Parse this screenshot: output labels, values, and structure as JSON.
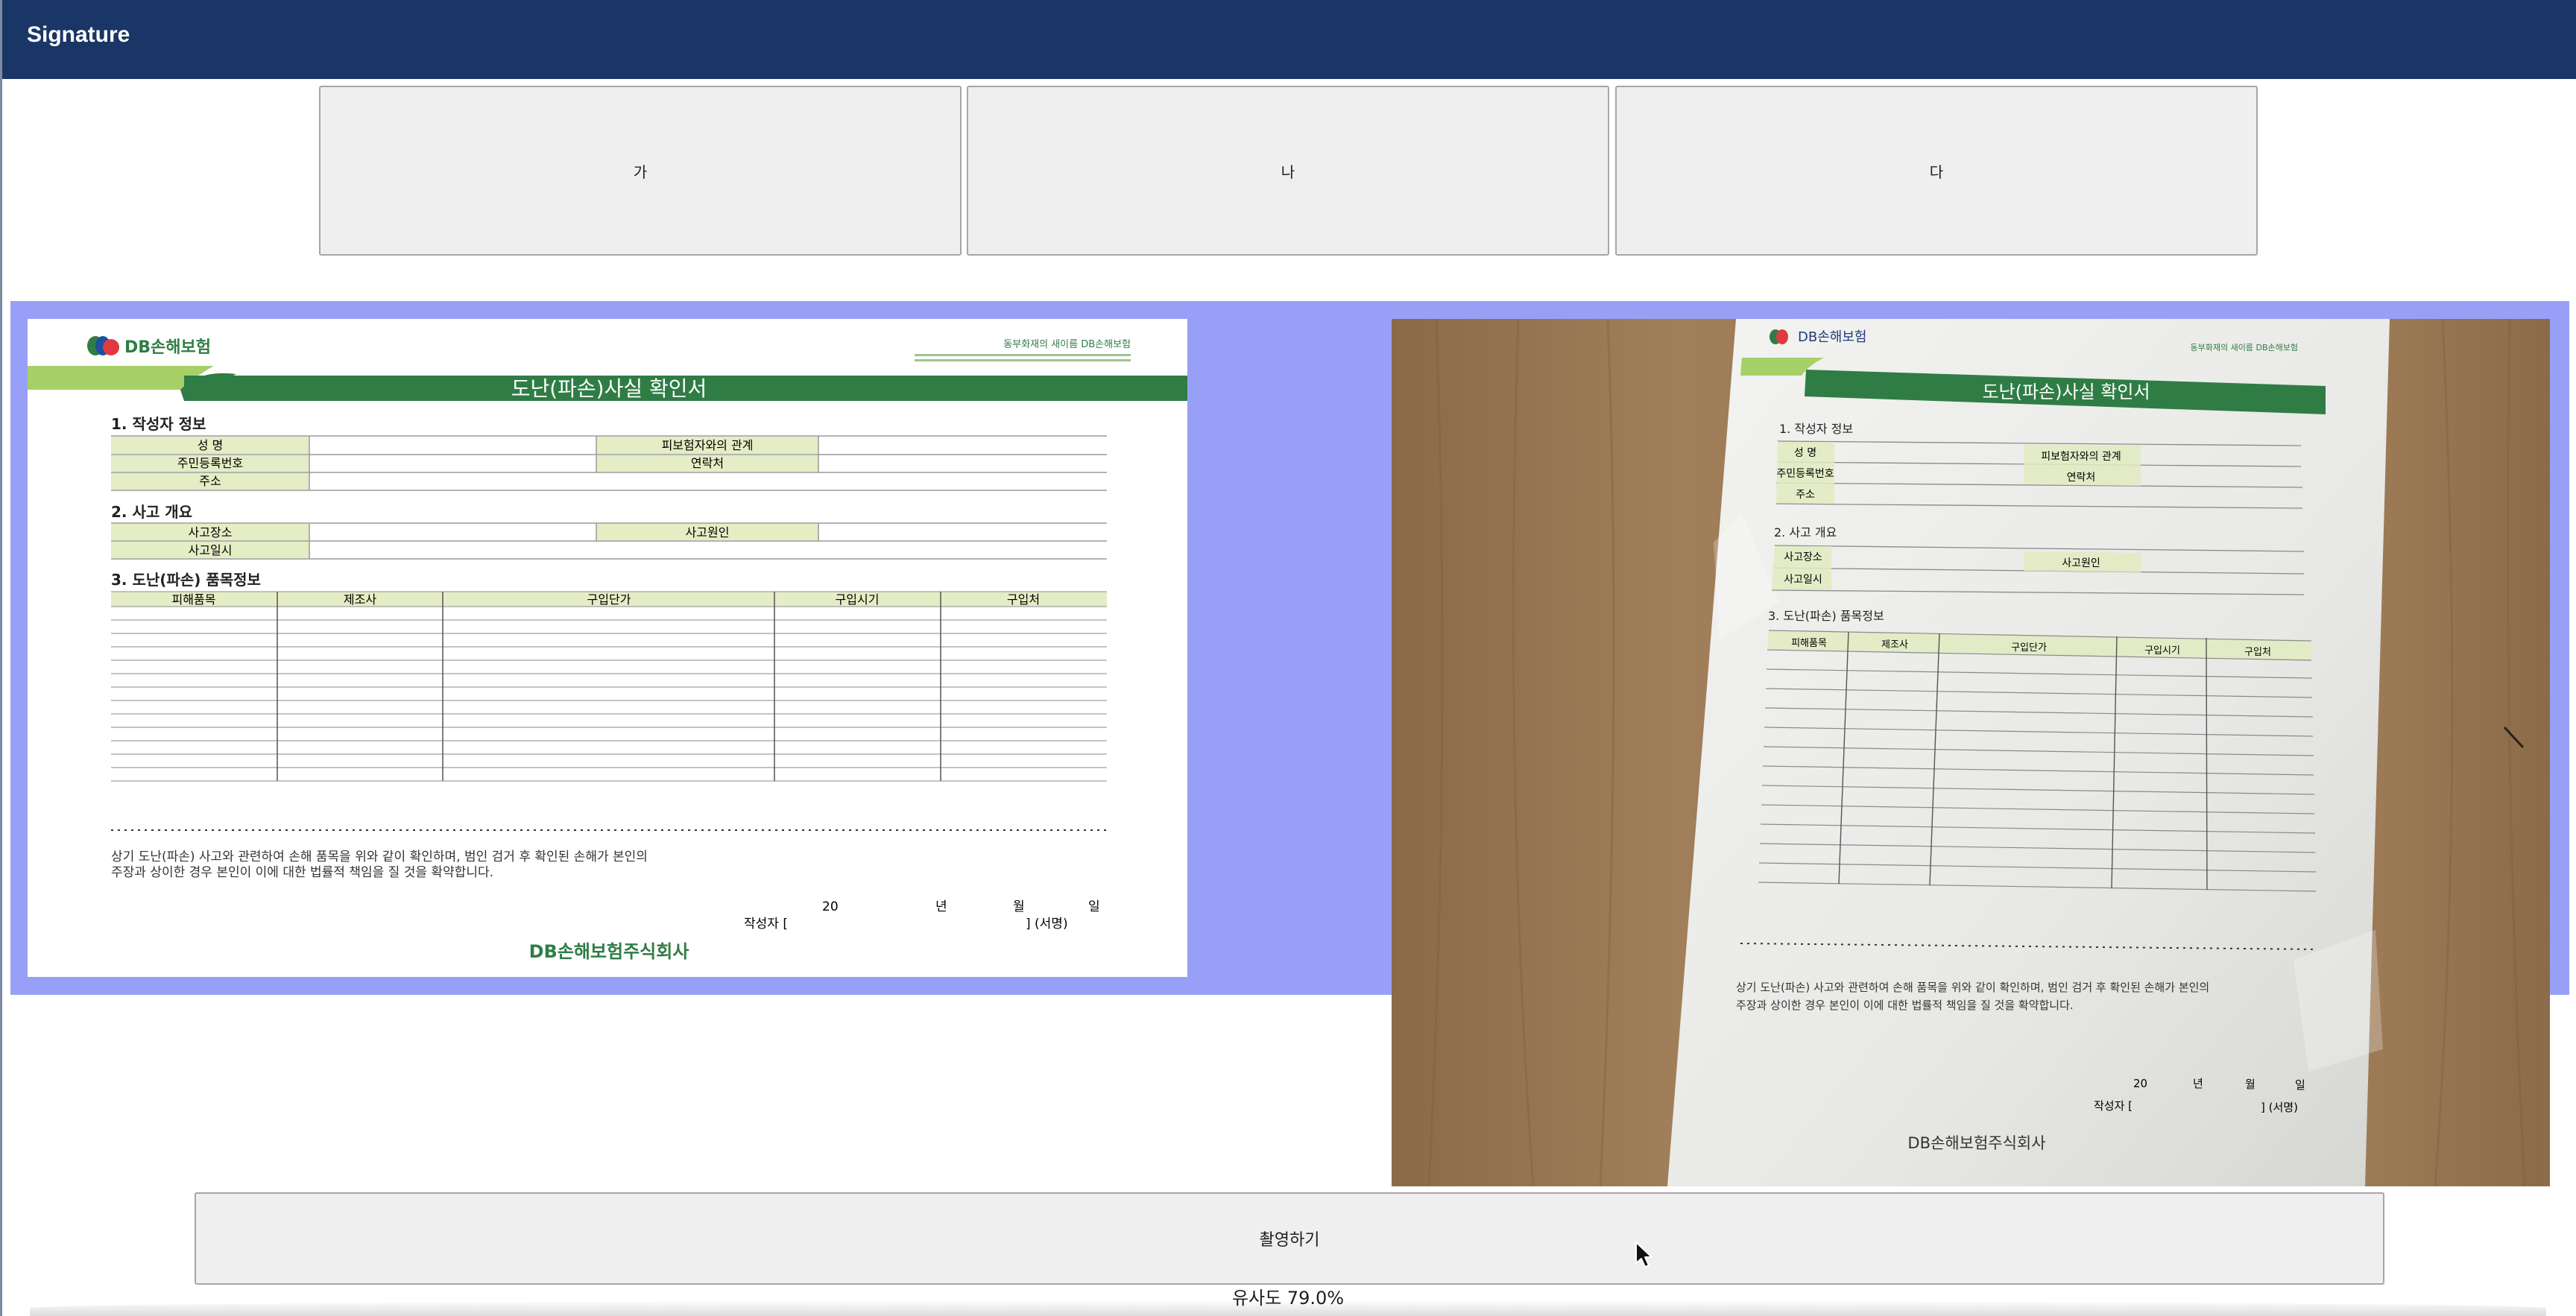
{
  "app": {
    "title": "Signature"
  },
  "options": [
    {
      "label": "가"
    },
    {
      "label": "나"
    },
    {
      "label": "다"
    }
  ],
  "colors": {
    "header": "#1a3667",
    "stage": "#97a0f6",
    "form_green": "#2f7d45",
    "form_cell": "#e4edc4"
  },
  "form": {
    "brand": "DB손해보험",
    "slogan": "동부화재의 새이름 DB손해보험",
    "title": "도난(파손)사실 확인서",
    "sections": {
      "writer": "1. 작성자 정보",
      "accident": "2. 사고 개요",
      "items": "3. 도난(파손) 품목정보"
    },
    "writer_fields": {
      "name": "성 명",
      "relation": "피보험자와의 관계",
      "id_number": "주민등록번호",
      "contact": "연락처",
      "address": "주소"
    },
    "accident_fields": {
      "place": "사고장소",
      "cause": "사고원인",
      "datetime": "사고일시"
    },
    "item_columns": [
      "피해품목",
      "제조사",
      "구입단가",
      "구입시기",
      "구입처"
    ],
    "statement_line1": "상기 도난(파손) 사고와 관련하여 손해 품목을 위와 같이 확인하며, 범인 검거 후 확인된 손해가 본인의",
    "statement_line2": "주장과 상이한 경우 본인이 이에 대한 법률적 책임을 질 것을 확약합니다.",
    "date_year": "20",
    "date_year_unit": "년",
    "date_month_unit": "월",
    "date_day_unit": "일",
    "signer_label": "작성자 [",
    "signer_suffix": "] (서명)",
    "company": "DB손해보험주식회사"
  },
  "actions": {
    "capture_label": "촬영하기"
  },
  "status": {
    "similarity_text": "유사도 79.0%"
  }
}
